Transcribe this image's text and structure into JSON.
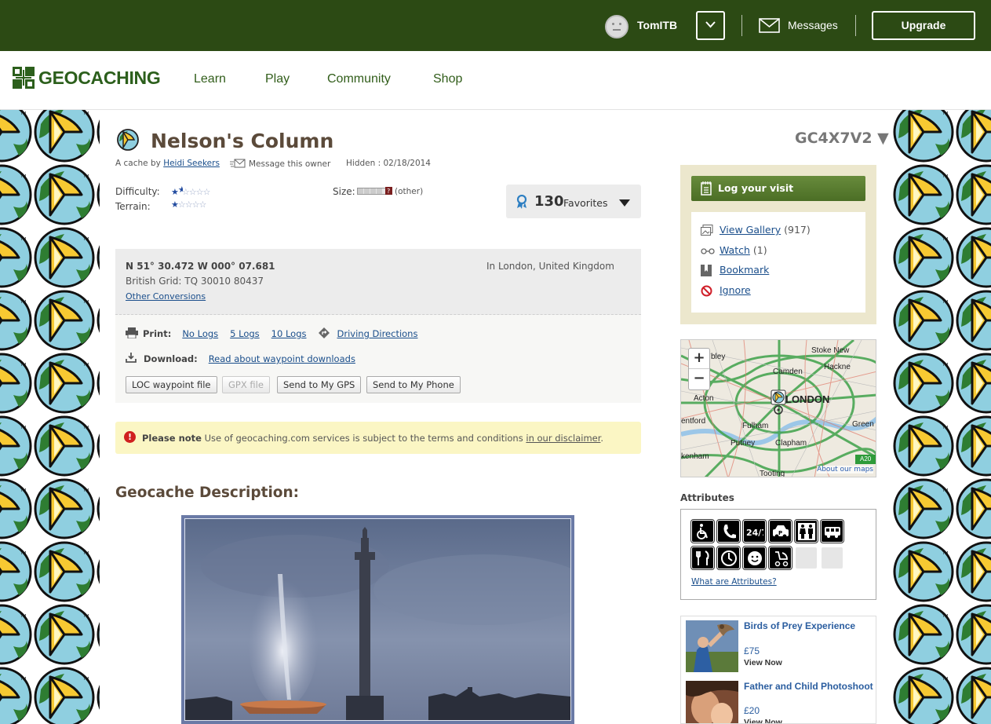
{
  "topbar": {
    "username": "TomITB",
    "messages_label": "Messages",
    "upgrade_label": "Upgrade"
  },
  "nav": {
    "logo_text": "GEOCACHING",
    "items": [
      "Learn",
      "Play",
      "Community",
      "Shop"
    ]
  },
  "cache": {
    "title": "Nelson's Column",
    "code": "GC4X7V2 ▼",
    "owner_prefix": "A cache by",
    "owner_name": "Heidi Seekers",
    "message_owner": "Message this owner",
    "hidden": "Hidden : 02/18/2014",
    "difficulty_label": "Difficulty:",
    "difficulty": 1.5,
    "terrain_label": "Terrain:",
    "terrain": 1,
    "size_label": "Size:",
    "size_value": "(other)",
    "favorites_count": "130",
    "favorites_label": "Favorites"
  },
  "coords": {
    "main": "N 51° 30.472 W 000° 07.681",
    "grid": "British Grid: TQ 30010 80437",
    "conversions": "Other Conversions",
    "location": "In London, United Kingdom"
  },
  "print": {
    "label": "Print:",
    "links": [
      "No Logs",
      "5 Logs",
      "10 Logs"
    ],
    "directions": "Driving Directions",
    "download_label": "Download:",
    "download_link": "Read about waypoint downloads",
    "buttons": [
      "LOC waypoint file",
      "GPX file",
      "Send to My GPS",
      "Send to My Phone"
    ]
  },
  "note": {
    "bold": "Please note",
    "text": " Use of geocaching.com services is subject to the terms and conditions ",
    "link": "in our disclaimer",
    "end": "."
  },
  "description_title": "Geocache Description:",
  "sidebar": {
    "log_visit": "Log your visit",
    "gallery": "View Gallery",
    "gallery_count": " (917)",
    "watch": "Watch",
    "watch_count": " (1)",
    "bookmark": "Bookmark",
    "ignore": "Ignore"
  },
  "map": {
    "labels": [
      "Stoke New",
      "Hackne",
      "Camden",
      "LONDON",
      "Acton",
      "entford",
      "Fulham",
      "Putney",
      "Clapham",
      "Green",
      "kenham",
      "Tooting",
      "bley",
      "A20"
    ],
    "about": "About our maps"
  },
  "attributes": {
    "title": "Attributes",
    "link": "What are Attributes?"
  },
  "ads": [
    {
      "title": "Birds of Prey Experience",
      "price": "£75",
      "cta": "View Now"
    },
    {
      "title": "Father and Child Photoshoot",
      "price": "£20",
      "cta": "View Now"
    }
  ],
  "colors": {
    "topbar": "#2c4a14",
    "brand_green": "#2c5f1c",
    "link": "#1a4e8b",
    "log_button": "#5a7d30"
  }
}
